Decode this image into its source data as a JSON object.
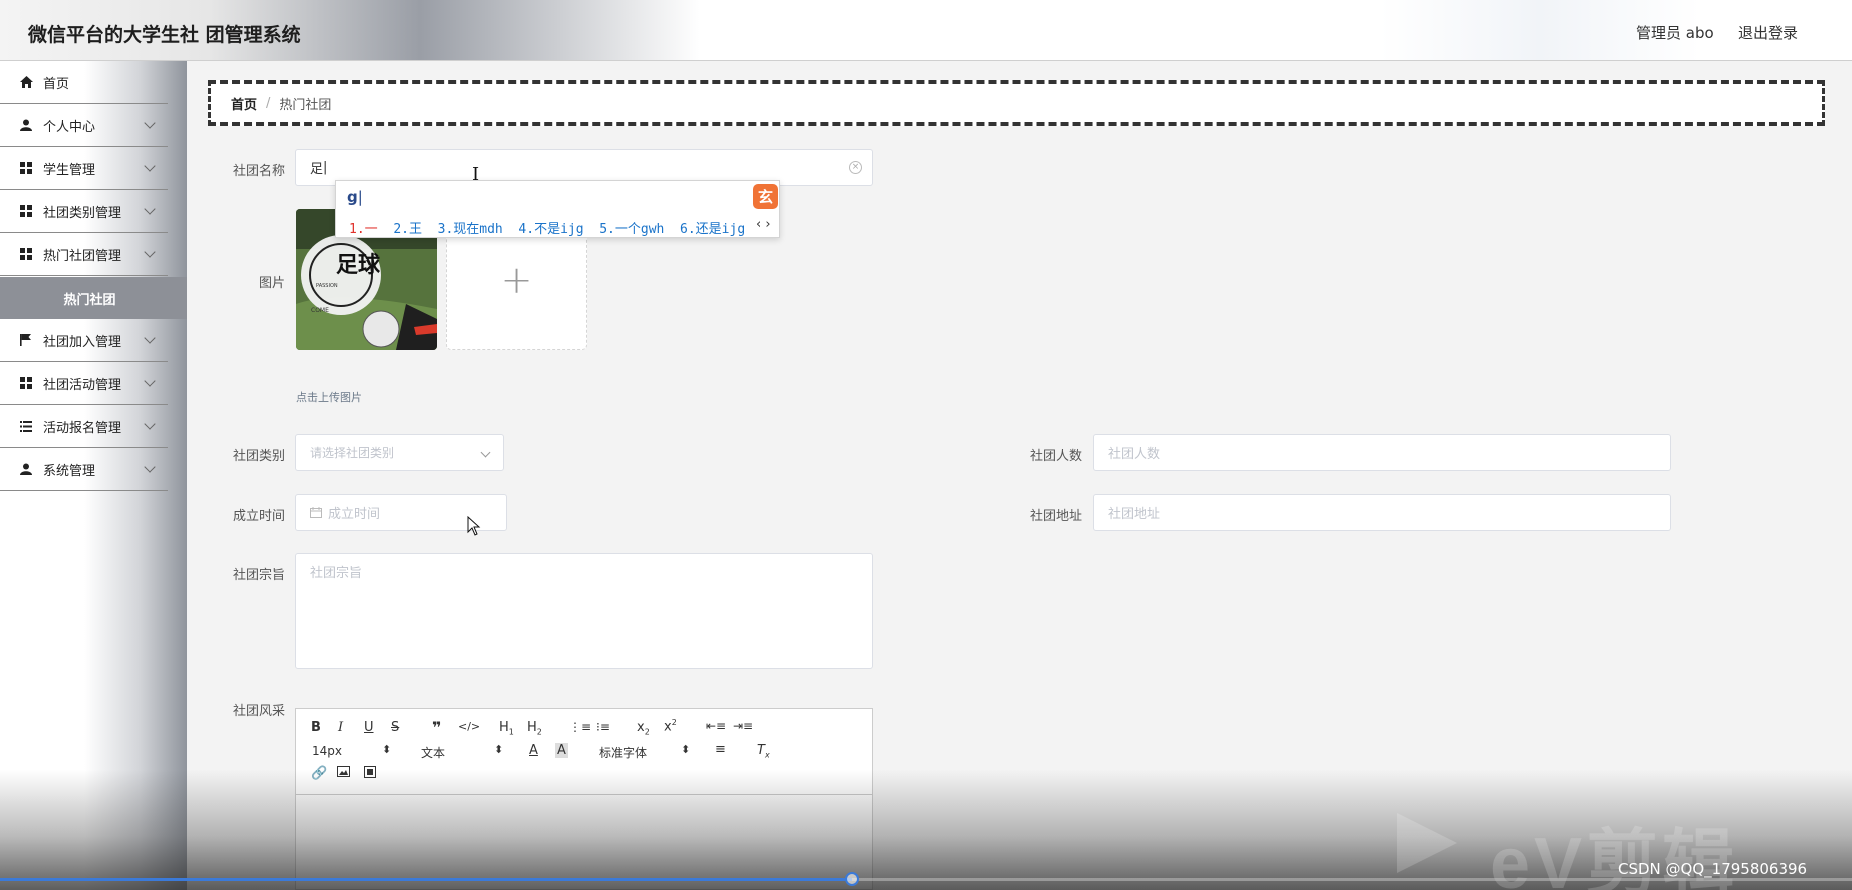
{
  "header": {
    "title": "微信平台的大学生社 团管理系统",
    "user": "管理员 abo",
    "logout": "退出登录"
  },
  "sidebar": {
    "items": [
      {
        "label": "首页",
        "icon": "home-icon"
      },
      {
        "label": "个人中心",
        "icon": "user-icon"
      },
      {
        "label": "学生管理",
        "icon": "grid-icon"
      },
      {
        "label": "社团类别管理",
        "icon": "grid-icon"
      },
      {
        "label": "热门社团管理",
        "icon": "grid-icon"
      },
      {
        "label": "社团加入管理",
        "icon": "flag-icon"
      },
      {
        "label": "社团活动管理",
        "icon": "grid-icon"
      },
      {
        "label": "活动报名管理",
        "icon": "list-icon"
      },
      {
        "label": "系统管理",
        "icon": "user-icon"
      }
    ],
    "active_sub": "热门社团"
  },
  "breadcrumb": {
    "home": "首页",
    "sep": "/",
    "current": "热门社团"
  },
  "form": {
    "name_label": "社团名称",
    "name_value": "足",
    "image_label": "图片",
    "upload_hint": "点击上传图片",
    "category_label": "社团类别",
    "category_placeholder": "请选择社团类别",
    "members_label": "社团人数",
    "members_placeholder": "社团人数",
    "founded_label": "成立时间",
    "founded_placeholder": "成立时间",
    "address_label": "社团地址",
    "address_placeholder": "社团地址",
    "purpose_label": "社团宗旨",
    "purpose_placeholder": "社团宗旨",
    "style_label": "社团风采"
  },
  "ime": {
    "composition": "g",
    "candidates": [
      "1.一",
      "2.王",
      "3.现在mdh",
      "4.不是ijg",
      "5.一个gwh",
      "6.还是ijg"
    ],
    "arrows": "‹ ›"
  },
  "editor": {
    "font_size": "14px",
    "block_type": "文本",
    "font_family": "标准字体"
  },
  "overlay": {
    "watermark": "eV剪辑",
    "credit": "CSDN @QQ_1795806396",
    "progress_percent": 46
  },
  "colors": {
    "sidebar_active": "#8d9097",
    "accent": "#3b7ad9",
    "ime_logo": "#f07336"
  }
}
